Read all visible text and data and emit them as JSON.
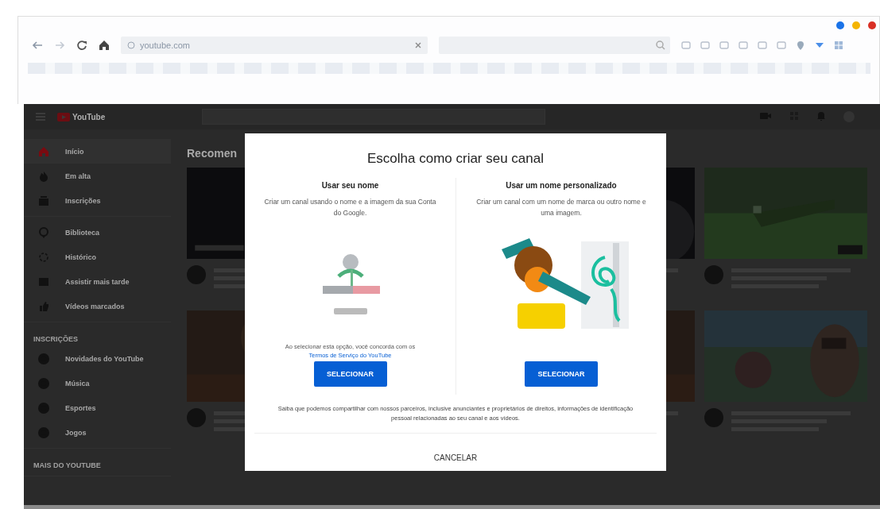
{
  "browser": {
    "address": "youtube.com"
  },
  "masthead": {
    "logo": "YouTube"
  },
  "sidebar": {
    "groups": [
      {
        "items": [
          {
            "label": "Início",
            "selected": true
          },
          {
            "label": "Em alta",
            "selected": false
          },
          {
            "label": "Inscrições",
            "selected": false
          }
        ]
      },
      {
        "items": [
          {
            "label": "Biblioteca",
            "selected": false
          },
          {
            "label": "Histórico",
            "selected": false
          },
          {
            "label": "Assistir mais tarde",
            "selected": false
          },
          {
            "label": "Vídeos marcados",
            "selected": false
          }
        ]
      },
      {
        "heading": "INSCRIÇÕES",
        "items": [
          {
            "label": "Novidades do YouTube",
            "selected": false
          },
          {
            "label": "Música",
            "selected": false
          },
          {
            "label": "Esportes",
            "selected": false
          },
          {
            "label": "Jogos",
            "selected": false
          }
        ]
      },
      {
        "heading": "MAIS DO YOUTUBE"
      }
    ]
  },
  "feed": {
    "heading": "Recomen"
  },
  "dialog": {
    "title": "Escolha como criar seu canal",
    "options": [
      {
        "kind": "account",
        "heading": "Usar seu nome",
        "description": "Criar um canal usando o nome e a imagem da sua Conta do Google.",
        "note": "Ao selecionar esta opção, você concorda com os",
        "link": "Termos de Serviço do YouTube",
        "button": "SELECIONAR"
      },
      {
        "kind": "custom",
        "heading": "Usar um nome personalizado",
        "description": "Criar um canal com um nome de marca ou outro nome e uma imagem.",
        "button": "SELECIONAR"
      }
    ],
    "disclaimer": "Saiba que podemos compartilhar com nossos parceiros, inclusive anunciantes e proprietários de direitos, informações de identificação pessoal relacionadas ao seu canal e aos vídeos.",
    "cancel": "CANCELAR"
  }
}
